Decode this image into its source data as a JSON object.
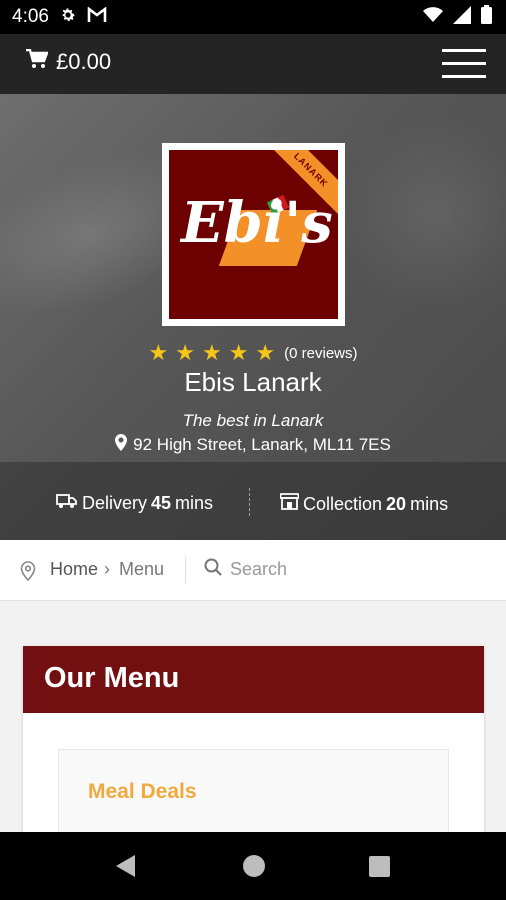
{
  "status_bar": {
    "time": "4:06",
    "icons": [
      "settings-icon",
      "gmail-icon",
      "wifi-icon",
      "signal-icon",
      "battery-icon"
    ]
  },
  "header": {
    "cart_total": "£0.00",
    "cart_icon": "cart-icon",
    "menu_icon": "hamburger-menu-icon"
  },
  "restaurant": {
    "logo_text": "Ebi's",
    "logo_ribbon": "LANARK",
    "rating_stars": 5,
    "reviews": "(0 reviews)",
    "name": "Ebis Lanark",
    "tagline": "The best in Lanark",
    "address": "92 High Street, Lanark, ML11 7ES"
  },
  "delivery": {
    "label": "Delivery",
    "time": "45",
    "unit": "mins"
  },
  "collection": {
    "label": "Collection",
    "time": "20",
    "unit": "mins"
  },
  "breadcrumb": {
    "home": "Home",
    "separator": "›",
    "current": "Menu"
  },
  "search": {
    "placeholder": "Search"
  },
  "menu": {
    "title": "Our Menu",
    "categories": [
      "Meal Deals"
    ]
  },
  "colors": {
    "accent": "#720f11",
    "star": "#f5c518",
    "category": "#f0a93e",
    "logo_bg": "#6d0000",
    "logo_orange": "#f39028"
  }
}
